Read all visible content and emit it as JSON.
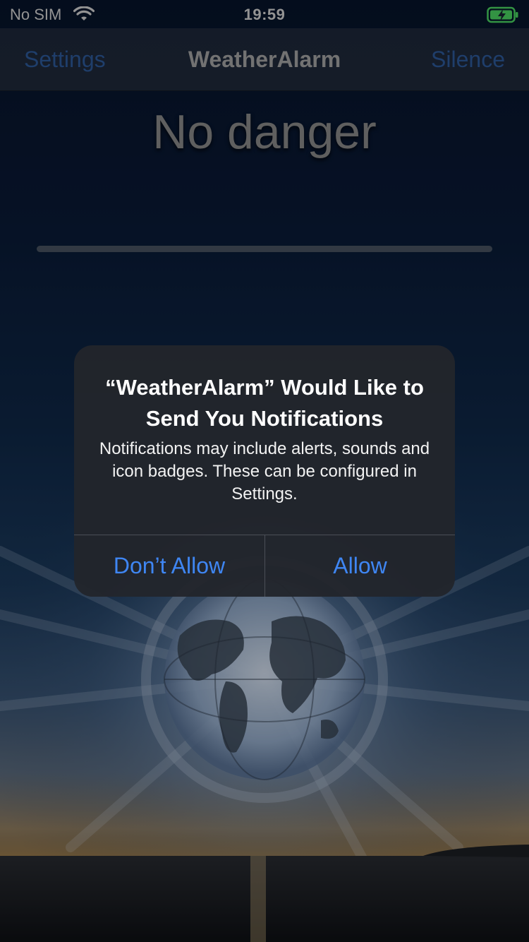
{
  "status_bar": {
    "carrier": "No SIM",
    "time": "19:59",
    "wifi_icon": "wifi-icon",
    "battery_icon": "battery-charging-icon",
    "battery_color": "#4cd964"
  },
  "nav_bar": {
    "left_button": "Settings",
    "title": "WeatherAlarm",
    "right_button": "Silence",
    "accent_color": "#2e5c9e"
  },
  "main": {
    "status_text": "No danger",
    "progress": 0
  },
  "alert": {
    "title": "“WeatherAlarm” Would Like to Send You Notifications",
    "message": "Notifications may include alerts, sounds and icon badges. These can be configured in Settings.",
    "buttons": [
      {
        "label": "Don’t Allow"
      },
      {
        "label": "Allow"
      }
    ],
    "button_color": "#3f86f3"
  },
  "background": {
    "globe_icon": "globe-puzzle-icon"
  }
}
